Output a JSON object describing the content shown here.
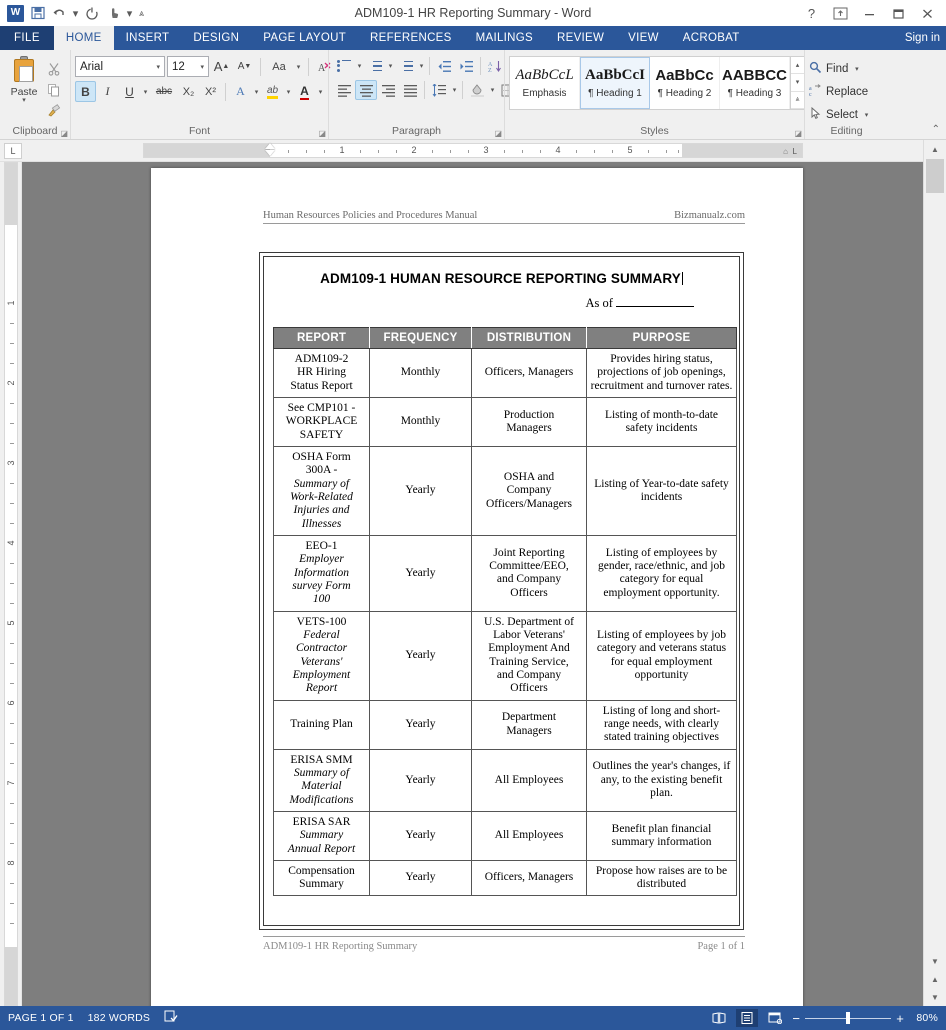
{
  "window": {
    "title": "ADM109-1 HR Reporting Summary - Word",
    "quick_access": [
      {
        "name": "word-logo-icon",
        "glyph": "W"
      },
      {
        "name": "save-icon",
        "glyph": "὚B"
      },
      {
        "name": "undo-icon",
        "glyph": "↶"
      },
      {
        "name": "undo-dropdown-icon",
        "glyph": "▾"
      },
      {
        "name": "redo-icon",
        "glyph": "↻"
      },
      {
        "name": "touch-mode-icon",
        "glyph": "☝"
      },
      {
        "name": "touch-mode-dropdown-icon",
        "glyph": "▾"
      },
      {
        "name": "customize-qat-icon",
        "glyph": "⨍"
      }
    ],
    "controls": [
      {
        "name": "help-button",
        "glyph": "?"
      },
      {
        "name": "ribbon-display-options-button",
        "glyph": "⬚"
      },
      {
        "name": "minimize-button",
        "glyph": "—"
      },
      {
        "name": "restore-button",
        "glyph": "❐"
      },
      {
        "name": "close-button",
        "glyph": "✕"
      }
    ]
  },
  "ribbon": {
    "file_tab": "FILE",
    "tabs": [
      "HOME",
      "INSERT",
      "DESIGN",
      "PAGE LAYOUT",
      "REFERENCES",
      "MAILINGS",
      "REVIEW",
      "VIEW",
      "ACROBAT"
    ],
    "active_tab": "HOME",
    "sign_in": "Sign in",
    "groups": {
      "clipboard": {
        "label": "Clipboard",
        "paste_label": "Paste",
        "cut_label": "Cut",
        "copy_label": "Copy",
        "format_painter_label": "Format Painter"
      },
      "font": {
        "label": "Font",
        "font_name": "Arial",
        "font_size": "12",
        "grow_font": "A",
        "shrink_font": "A",
        "change_case": "Aa",
        "clear_formatting": "✐",
        "bold": "B",
        "italic": "I",
        "underline": "U",
        "strikethrough": "abc",
        "subscript": "X₂",
        "superscript": "X²",
        "text_effects": "A",
        "highlight": "ab",
        "font_color": "A"
      },
      "paragraph": {
        "label": "Paragraph",
        "bullets": "bullets-icon",
        "numbering": "numbering-icon",
        "multilevel": "multilevel-list-icon",
        "decrease_indent": "decrease-indent-icon",
        "increase_indent": "increase-indent-icon",
        "sort": "sort-icon",
        "show_marks": "¶",
        "align_left": "align-left-icon",
        "align_center": "align-center-icon",
        "align_right": "align-right-icon",
        "justify": "justify-icon",
        "line_spacing": "line-spacing-icon",
        "shading": "shading-icon",
        "borders": "borders-icon"
      },
      "styles": {
        "label": "Styles",
        "items": [
          {
            "preview": "AaBbCcL",
            "name": "Emphasis",
            "selected": false,
            "italic": true,
            "bold": false
          },
          {
            "preview": "AaBbCcI",
            "name": "¶ Heading 1",
            "selected": true,
            "italic": false,
            "bold": true
          },
          {
            "preview": "AaBbCc",
            "name": "¶ Heading 2",
            "selected": false,
            "italic": false,
            "bold": true
          },
          {
            "preview": "AABBCC",
            "name": "¶ Heading 3",
            "selected": false,
            "italic": false,
            "bold": true
          }
        ]
      },
      "editing": {
        "label": "Editing",
        "find": "Find",
        "replace": "Replace",
        "select": "Select"
      }
    }
  },
  "ruler": {
    "horizontal_numbers": [
      "1",
      "2",
      "3",
      "4",
      "5"
    ],
    "vertical_numbers": [
      "1",
      "2",
      "3",
      "4",
      "5",
      "6",
      "7",
      "8"
    ]
  },
  "document": {
    "header_left": "Human Resources Policies and Procedures Manual",
    "header_right": "Bizmanualz.com",
    "footer_left": "ADM109-1 HR Reporting Summary",
    "footer_right": "Page 1 of 1",
    "form_title": "ADM109-1 HUMAN RESOURCE REPORTING SUMMARY",
    "as_of_label": "As of",
    "table": {
      "columns": [
        "REPORT",
        "FREQUENCY",
        "DISTRIBUTION",
        "PURPOSE"
      ],
      "rows": [
        {
          "report": "ADM109-2\nHR Hiring\nStatus Report",
          "report_italic": "",
          "frequency": "Monthly",
          "distribution": "Officers, Managers",
          "purpose": "Provides hiring status, projections of job openings, recruitment and turnover rates."
        },
        {
          "report": "See CMP101 -\nWORKPLACE\nSAFETY",
          "report_italic": "",
          "frequency": "Monthly",
          "distribution": "Production\nManagers",
          "purpose": "Listing of month-to-date safety incidents"
        },
        {
          "report": "OSHA Form\n300A -",
          "report_italic": "Summary of\nWork-Related\nInjuries and\nIllnesses",
          "frequency": "Yearly",
          "distribution": "OSHA and\nCompany\nOfficers/Managers",
          "purpose": "Listing of Year-to-date safety incidents"
        },
        {
          "report": "EEO-1",
          "report_italic": "Employer\nInformation\nsurvey Form\n100",
          "frequency": "Yearly",
          "distribution": "Joint Reporting\nCommittee/EEO,\nand Company\nOfficers",
          "purpose": "Listing of employees by gender, race/ethnic, and job category for equal employment opportunity."
        },
        {
          "report": "VETS-100",
          "report_italic": "Federal\nContractor\nVeterans'\nEmployment\nReport",
          "frequency": "Yearly",
          "distribution": "U.S. Department of\nLabor Veterans'\nEmployment And\nTraining Service,\nand Company\nOfficers",
          "purpose": "Listing of employees by job category and veterans status for equal employment opportunity"
        },
        {
          "report": "Training Plan",
          "report_italic": "",
          "frequency": "Yearly",
          "distribution": "Department\nManagers",
          "purpose": "Listing of long and short-range needs, with clearly stated training objectives"
        },
        {
          "report": "ERISA SMM",
          "report_italic": "Summary of\nMaterial\nModifications",
          "frequency": "Yearly",
          "distribution": "All Employees",
          "purpose": "Outlines the year's changes, if any, to the existing benefit plan."
        },
        {
          "report": "ERISA SAR",
          "report_italic": "Summary\nAnnual Report",
          "frequency": "Yearly",
          "distribution": "All Employees",
          "purpose": "Benefit plan financial summary information"
        },
        {
          "report": "Compensation\nSummary",
          "report_italic": "",
          "frequency": "Yearly",
          "distribution": "Officers, Managers",
          "purpose": "Propose how raises are to be distributed"
        }
      ]
    }
  },
  "statusbar": {
    "page_info": "PAGE 1 OF 1",
    "word_count": "182 WORDS",
    "proofing_icon": "proofing-errors-icon",
    "views": [
      {
        "name": "read-mode-view-button",
        "glyph": "▯",
        "active": false
      },
      {
        "name": "print-layout-view-button",
        "glyph": "▤",
        "active": true
      },
      {
        "name": "web-layout-view-button",
        "glyph": "▧",
        "active": false
      }
    ],
    "zoom_out": "−",
    "zoom_in": "+",
    "zoom_level": "80%"
  },
  "colors": {
    "accent": "#2b579a",
    "file_tab": "#1e3f73",
    "table_header": "#808080",
    "doc_background": "#7e7e7e"
  }
}
